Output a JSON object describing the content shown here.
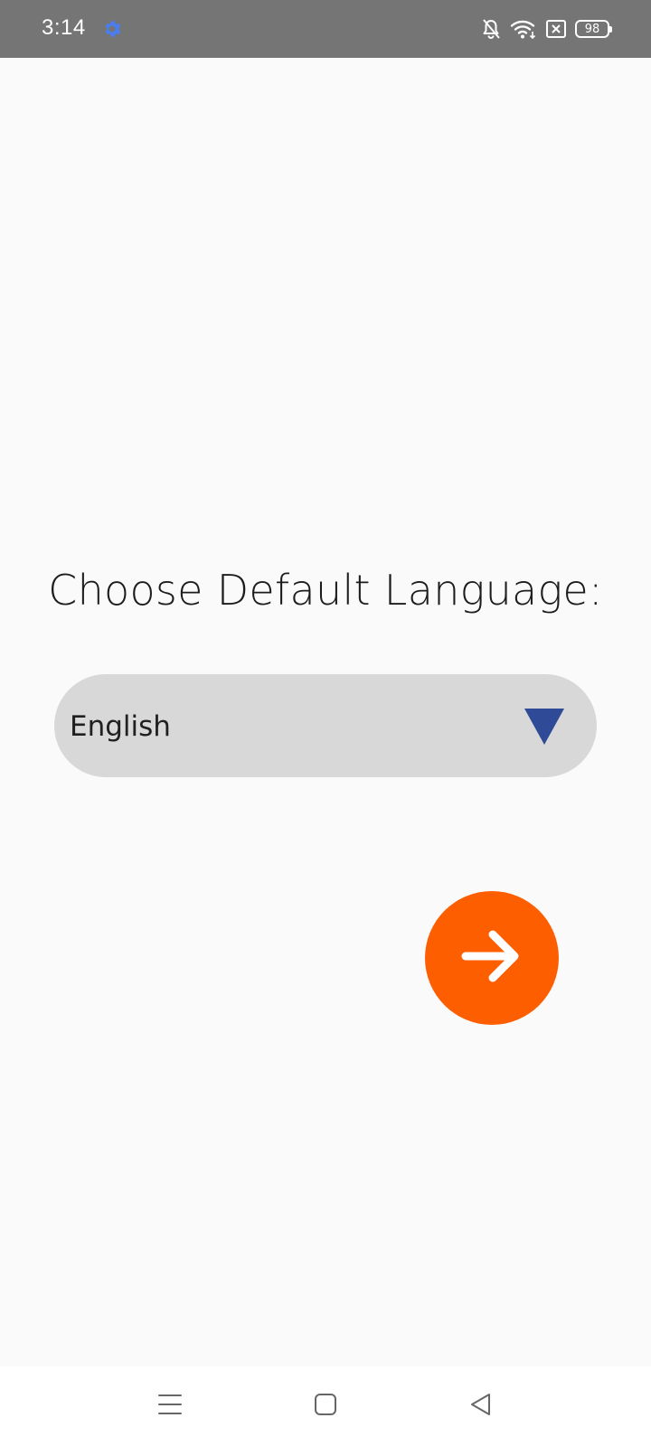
{
  "status_bar": {
    "time": "3:14",
    "battery_level": "98",
    "icons": [
      "settings-gear-icon",
      "bell-off-icon",
      "wifi-icon",
      "sim-x-icon",
      "battery-icon"
    ]
  },
  "main": {
    "title": "Choose Default Language:",
    "language_dropdown": {
      "selected_value": "English"
    },
    "next_button": {
      "icon": "arrow-right-icon"
    }
  },
  "navigation_bar": {
    "icons": [
      "menu-icon",
      "home-square-icon",
      "back-triangle-icon"
    ]
  },
  "colors": {
    "status_bar_bg": "#757575",
    "page_bg": "#fafafa",
    "dropdown_bg": "#d8d8d8",
    "dropdown_arrow": "#2f4a96",
    "next_button_bg": "#fd5f00",
    "gear_icon": "#4a7df0"
  }
}
